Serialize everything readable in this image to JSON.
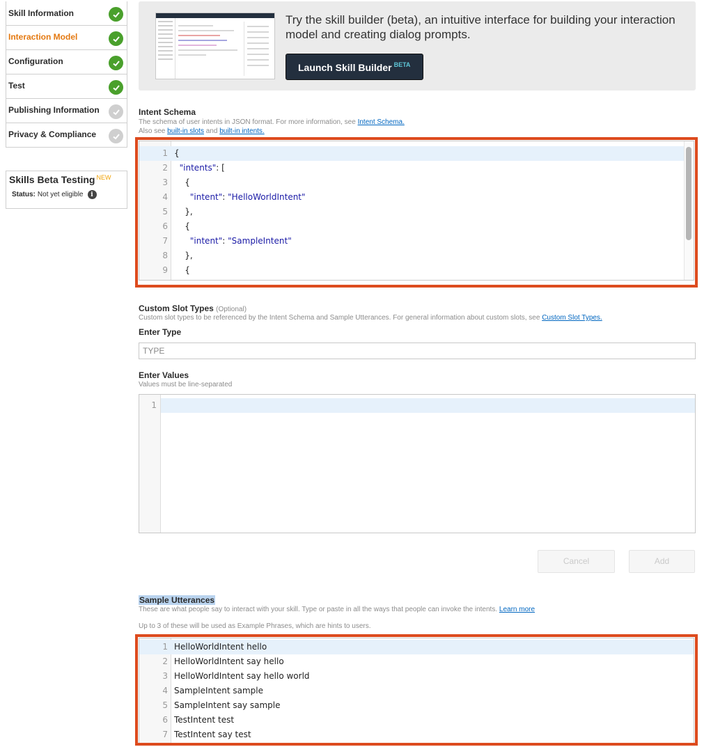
{
  "nav": {
    "items": [
      {
        "label": "Skill Information",
        "status": "done"
      },
      {
        "label": "Interaction Model",
        "status": "done",
        "active": true
      },
      {
        "label": "Configuration",
        "status": "done"
      },
      {
        "label": "Test",
        "status": "done"
      },
      {
        "label": "Publishing Information",
        "status": "pending"
      },
      {
        "label": "Privacy & Compliance",
        "status": "pending"
      }
    ]
  },
  "beta_testing": {
    "title": "Skills Beta Testing",
    "badge": "NEW",
    "status_label": "Status:",
    "status_value": "Not yet eligible",
    "info_icon": "info-icon"
  },
  "promo": {
    "text": "Try the skill builder (beta), an intuitive interface for building your interaction model and creating dialog prompts.",
    "button_label": "Launch Skill Builder",
    "button_badge": "BETA"
  },
  "intent_schema": {
    "title": "Intent Schema",
    "desc_prefix": "The schema of user intents in JSON format. For more information, see ",
    "desc_link": "Intent Schema.",
    "desc2_prefix": "Also see ",
    "desc2_link1": "built-in slots",
    "desc2_mid": " and ",
    "desc2_link2": "built-in intents.",
    "lines": [
      {
        "n": "1",
        "text": "{"
      },
      {
        "n": "2",
        "text": "  \"intents\": ["
      },
      {
        "n": "3",
        "text": "    {"
      },
      {
        "n": "4",
        "text": "      \"intent\": \"HelloWorldIntent\""
      },
      {
        "n": "5",
        "text": "    },"
      },
      {
        "n": "6",
        "text": "    {"
      },
      {
        "n": "7",
        "text": "      \"intent\": \"SampleIntent\""
      },
      {
        "n": "8",
        "text": "    },"
      },
      {
        "n": "9",
        "text": "    {"
      }
    ]
  },
  "custom_slots": {
    "title": "Custom Slot Types",
    "optional": "(Optional)",
    "desc_prefix": "Custom slot types to be referenced by the Intent Schema and Sample Utterances. For general information about custom slots, see ",
    "desc_link": "Custom Slot Types.",
    "type_label": "Enter Type",
    "type_placeholder": "TYPE",
    "values_label": "Enter Values",
    "values_hint": "Values must be line-separated",
    "values_line": "1",
    "cancel_label": "Cancel",
    "add_label": "Add"
  },
  "sample_utterances": {
    "title": "Sample Utterances",
    "desc_prefix": "These are what people say to interact with your skill. Type or paste in all the ways that people can invoke the intents. ",
    "desc_link": "Learn more",
    "desc2": "Up to 3 of these will be used as Example Phrases, which are hints to users.",
    "lines": [
      {
        "n": "1",
        "text": "HelloWorldIntent hello"
      },
      {
        "n": "2",
        "text": "HelloWorldIntent say hello"
      },
      {
        "n": "3",
        "text": "HelloWorldIntent say hello world"
      },
      {
        "n": "4",
        "text": "SampleIntent sample"
      },
      {
        "n": "5",
        "text": "SampleIntent say sample"
      },
      {
        "n": "6",
        "text": "TestIntent test"
      },
      {
        "n": "7",
        "text": "TestIntent say test"
      }
    ]
  },
  "colors": {
    "accent": "#e47911",
    "check_done": "#4aa02c",
    "check_pending": "#cfcfcf",
    "highlight_frame": "#dd4b1e",
    "link": "#0066c0"
  }
}
